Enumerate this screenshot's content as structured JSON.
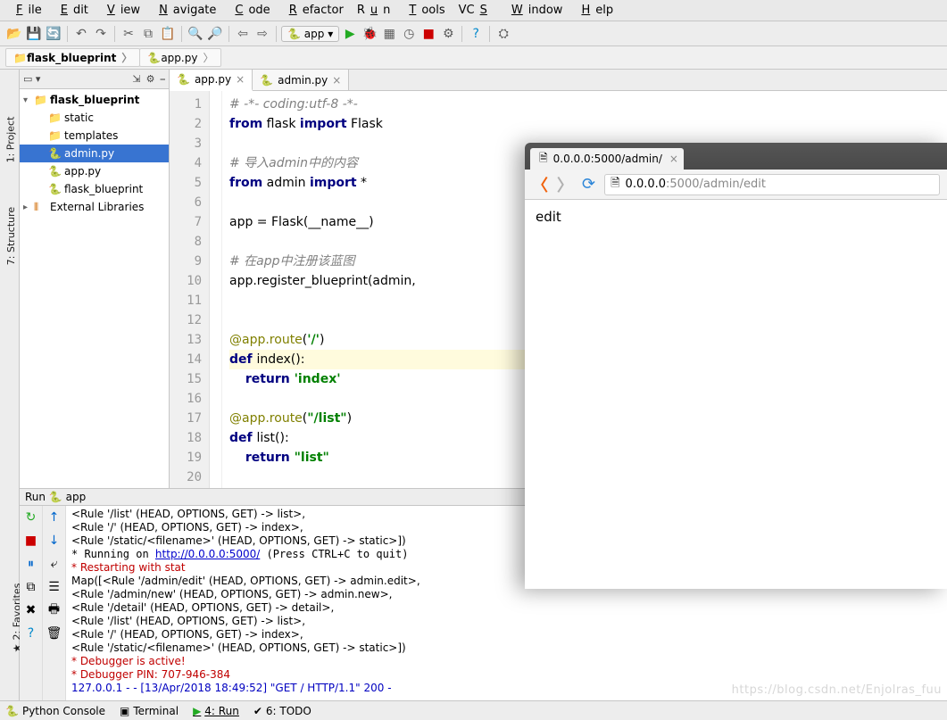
{
  "menu": {
    "file": "File",
    "edit": "Edit",
    "view": "View",
    "navigate": "Navigate",
    "code": "Code",
    "refactor": "Refactor",
    "run": "Run",
    "tools": "Tools",
    "vcs": "VCS",
    "window": "Window",
    "help": "Help"
  },
  "toolbar": {
    "config_label": "app"
  },
  "crumbs": {
    "project": "flask_blueprint",
    "file": "app.py"
  },
  "project": {
    "root": "flask_blueprint",
    "items": [
      {
        "label": "static",
        "kind": "folder"
      },
      {
        "label": "templates",
        "kind": "folder-purple"
      },
      {
        "label": "admin.py",
        "kind": "py",
        "selected": true
      },
      {
        "label": "app.py",
        "kind": "py"
      },
      {
        "label": "flask_blueprint",
        "kind": "py-trail",
        "trail": true
      }
    ],
    "external": "External Libraries"
  },
  "tabs": [
    {
      "label": "app.py",
      "active": true
    },
    {
      "label": "admin.py",
      "active": false
    }
  ],
  "code": {
    "lines": [
      {
        "n": 1,
        "seg": [
          {
            "c": "c",
            "t": "# -*- coding:utf-8 -*-"
          }
        ]
      },
      {
        "n": 2,
        "seg": [
          {
            "c": "kw",
            "t": "from"
          },
          {
            "c": "id",
            "t": " flask "
          },
          {
            "c": "kw",
            "t": "import"
          },
          {
            "c": "id",
            "t": " Flask"
          }
        ]
      },
      {
        "n": 3,
        "seg": []
      },
      {
        "n": 4,
        "seg": [
          {
            "c": "c",
            "t": "# 导入admin中的内容"
          }
        ]
      },
      {
        "n": 5,
        "seg": [
          {
            "c": "kw",
            "t": "from"
          },
          {
            "c": "id",
            "t": " admin "
          },
          {
            "c": "kw",
            "t": "import"
          },
          {
            "c": "id",
            "t": " *"
          }
        ]
      },
      {
        "n": 6,
        "seg": []
      },
      {
        "n": 7,
        "seg": [
          {
            "c": "id",
            "t": "app = Flask(__name__)"
          }
        ]
      },
      {
        "n": 8,
        "seg": []
      },
      {
        "n": 9,
        "seg": [
          {
            "c": "c",
            "t": "# 在app中注册该蓝图"
          }
        ]
      },
      {
        "n": 10,
        "seg": [
          {
            "c": "id",
            "t": "app.register_blueprint(admin,"
          }
        ]
      },
      {
        "n": 11,
        "seg": []
      },
      {
        "n": 12,
        "seg": []
      },
      {
        "n": 13,
        "seg": [
          {
            "c": "dec",
            "t": "@app.route"
          },
          {
            "c": "id",
            "t": "("
          },
          {
            "c": "str",
            "t": "'/'"
          },
          {
            "c": "id",
            "t": ")"
          }
        ]
      },
      {
        "n": 14,
        "hl": true,
        "seg": [
          {
            "c": "kw",
            "t": "def "
          },
          {
            "c": "id",
            "t": "index():"
          }
        ]
      },
      {
        "n": 15,
        "seg": [
          {
            "c": "id",
            "t": "    "
          },
          {
            "c": "kw",
            "t": "return "
          },
          {
            "c": "str",
            "t": "'index'"
          }
        ]
      },
      {
        "n": 16,
        "seg": []
      },
      {
        "n": 17,
        "seg": [
          {
            "c": "dec",
            "t": "@app.route"
          },
          {
            "c": "id",
            "t": "("
          },
          {
            "c": "str",
            "t": "\"/list\""
          },
          {
            "c": "id",
            "t": ")"
          }
        ]
      },
      {
        "n": 18,
        "seg": [
          {
            "c": "kw",
            "t": "def "
          },
          {
            "c": "id",
            "t": "list():"
          }
        ]
      },
      {
        "n": 19,
        "seg": [
          {
            "c": "id",
            "t": "    "
          },
          {
            "c": "kw",
            "t": "return "
          },
          {
            "c": "str",
            "t": "\"list\""
          }
        ]
      },
      {
        "n": 20,
        "seg": []
      }
    ]
  },
  "run": {
    "title": "Run",
    "config": "app",
    "out": [
      {
        "t": "<Rule '/list' (HEAD, OPTIONS, GET) -> list>,"
      },
      {
        "t": " <Rule '/' (HEAD, OPTIONS, GET) -> index>,"
      },
      {
        "t": " <Rule '/static/<filename>' (HEAD, OPTIONS, GET) -> static>])"
      },
      {
        "pre": " * Running on ",
        "link": "http://0.0.0.0:5000/",
        "post": " (Press CTRL+C to quit)"
      },
      {
        "cls": "red",
        "t": " * Restarting with stat"
      },
      {
        "t": "Map([<Rule '/admin/edit' (HEAD, OPTIONS, GET) -> admin.edit>,"
      },
      {
        "t": " <Rule '/admin/new' (HEAD, OPTIONS, GET) -> admin.new>,"
      },
      {
        "t": " <Rule '/detail' (HEAD, OPTIONS, GET) -> detail>,"
      },
      {
        "t": " <Rule '/list' (HEAD, OPTIONS, GET) -> list>,"
      },
      {
        "t": " <Rule '/' (HEAD, OPTIONS, GET) -> index>,"
      },
      {
        "t": " <Rule '/static/<filename>' (HEAD, OPTIONS, GET) -> static>])"
      },
      {
        "cls": "red",
        "t": " * Debugger is active!"
      },
      {
        "cls": "red",
        "t": " * Debugger PIN: 707-946-384"
      },
      {
        "cls": "blue",
        "t": "127.0.0.1 - - [13/Apr/2018 18:49:52] \"GET / HTTP/1.1\" 200 -"
      }
    ]
  },
  "status": {
    "python_console": "Python Console",
    "terminal": "Terminal",
    "run": "4: Run",
    "todo": "6: TODO"
  },
  "sidestrip": {
    "project": "1: Project",
    "structure": "7: Structure",
    "favorites": "2: Favorites"
  },
  "browser": {
    "tab_title": "0.0.0.0:5000/admin/",
    "url_host": "0.0.0.0",
    "url_rest": ":5000/admin/edit",
    "body": "edit"
  },
  "watermark": "https://blog.csdn.net/Enjolras_fuu"
}
